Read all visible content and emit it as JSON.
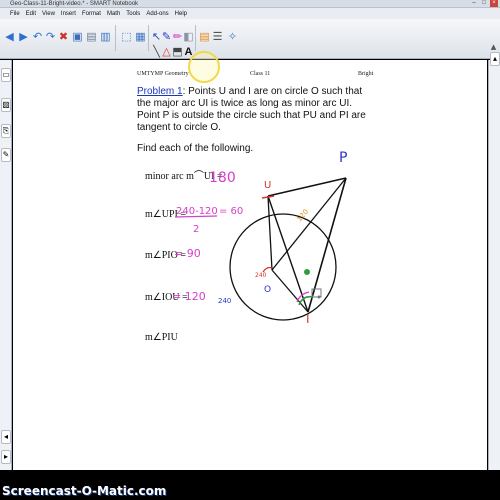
{
  "window": {
    "title": "Geo-Class-11-Bright-video.* - SMART Notebook",
    "controls": {
      "minimize": "–",
      "maximize": "□",
      "close": "×"
    }
  },
  "menu": [
    "File",
    "Edit",
    "View",
    "Insert",
    "Format",
    "Math",
    "Tools",
    "Add-ons",
    "Help"
  ],
  "toolbar_icons": [
    "previous-page-icon",
    "next-page-icon",
    "undo-icon",
    "redo-icon",
    "delete-icon",
    "save-icon",
    "paste-icon",
    "screen-shade-icon",
    "full-screen-icon",
    "table-icon",
    "document-camera-icon",
    "select-icon",
    "pen-icon",
    "highlighter-icon",
    "eraser-icon",
    "line-icon",
    "shape-icon",
    "fill-icon",
    "text-icon",
    "properties-icon",
    "more-icon",
    "magic-pen-icon"
  ],
  "header": {
    "left": "UMTYMP Geometry",
    "center": "Class 11",
    "right": "Bright"
  },
  "problem": {
    "label": "Problem 1",
    "text": ": Points U and I are on circle O such that the major arc UI is twice as long as minor arc UI.  Point P is outside the circle such that PU and PI are tangent to circle O."
  },
  "find": "Find each of the following.",
  "questions": [
    {
      "label": "minor arc  m⌒UI =",
      "answer": "180"
    },
    {
      "label": "m∠UPI =",
      "answer": "240 - 120 / 2 = 60"
    },
    {
      "label": "m∠PIO =",
      "answer": "90"
    },
    {
      "label": "m∠IOU =",
      "answer": "120"
    },
    {
      "label": "m∠PIU",
      "answer": ""
    }
  ],
  "handwriting": {
    "ans1": "180",
    "ans2_num": "240-120",
    "ans2_den": "2",
    "ans2_eq": "= 60",
    "ans3": "= 90",
    "ans4": "= 120",
    "pt_P": "P",
    "pt_U": "U",
    "pt_I": "I",
    "pt_O": "O",
    "arc_120": "120",
    "arc_240": "240",
    "angle_240": "240"
  },
  "colors": {
    "ink_black": "#111111",
    "ink_blue": "#2b35c9",
    "ink_magenta": "#d63fcb",
    "ink_red": "#d9342b",
    "ink_green": "#2e9e3a",
    "ink_orange": "#e48a1a"
  },
  "watermark": "Screencast-O-Matic.com"
}
